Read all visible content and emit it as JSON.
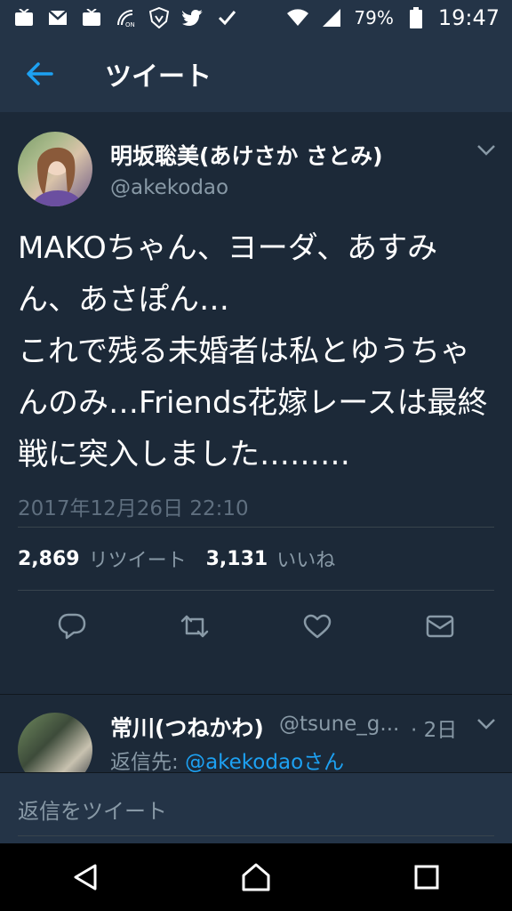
{
  "status_bar": {
    "battery_percent": "79%",
    "time": "19:47",
    "left_icons": [
      "tv-icon",
      "gmail-icon",
      "tv-icon",
      "nfc-icon",
      "shield-icon",
      "twitter-icon",
      "check-icon"
    ],
    "right_icons": [
      "wifi-icon",
      "signal-icon",
      "battery-icon"
    ]
  },
  "header": {
    "title": "ツイート"
  },
  "tweet": {
    "author_name": "明坂聡美(あけさか さとみ)",
    "author_handle": "@akekodao",
    "text": "MAKOちゃん、ヨーダ、あすみん、あさぽん…\nこれで残る未婚者は私とゆうちゃんのみ…Friends花嫁レースは最終戦に突入しました………",
    "date": "2017年12月26日 22:10",
    "retweets": "2,869",
    "retweets_label": "リツイート",
    "likes": "3,131",
    "likes_label": "いいね",
    "actions": [
      "reply-icon",
      "retweet-icon",
      "like-icon",
      "message-icon"
    ]
  },
  "reply": {
    "author_name": "常川(つねかわ)",
    "author_handle": "@tsune_g...",
    "time": "· 2日",
    "reply_to_label": "返信先: ",
    "reply_to_user": "@akekodaoさん"
  },
  "compose": {
    "placeholder": "返信をツイート"
  },
  "accent_color": "#1da1f2",
  "background_color": "#1c2938"
}
